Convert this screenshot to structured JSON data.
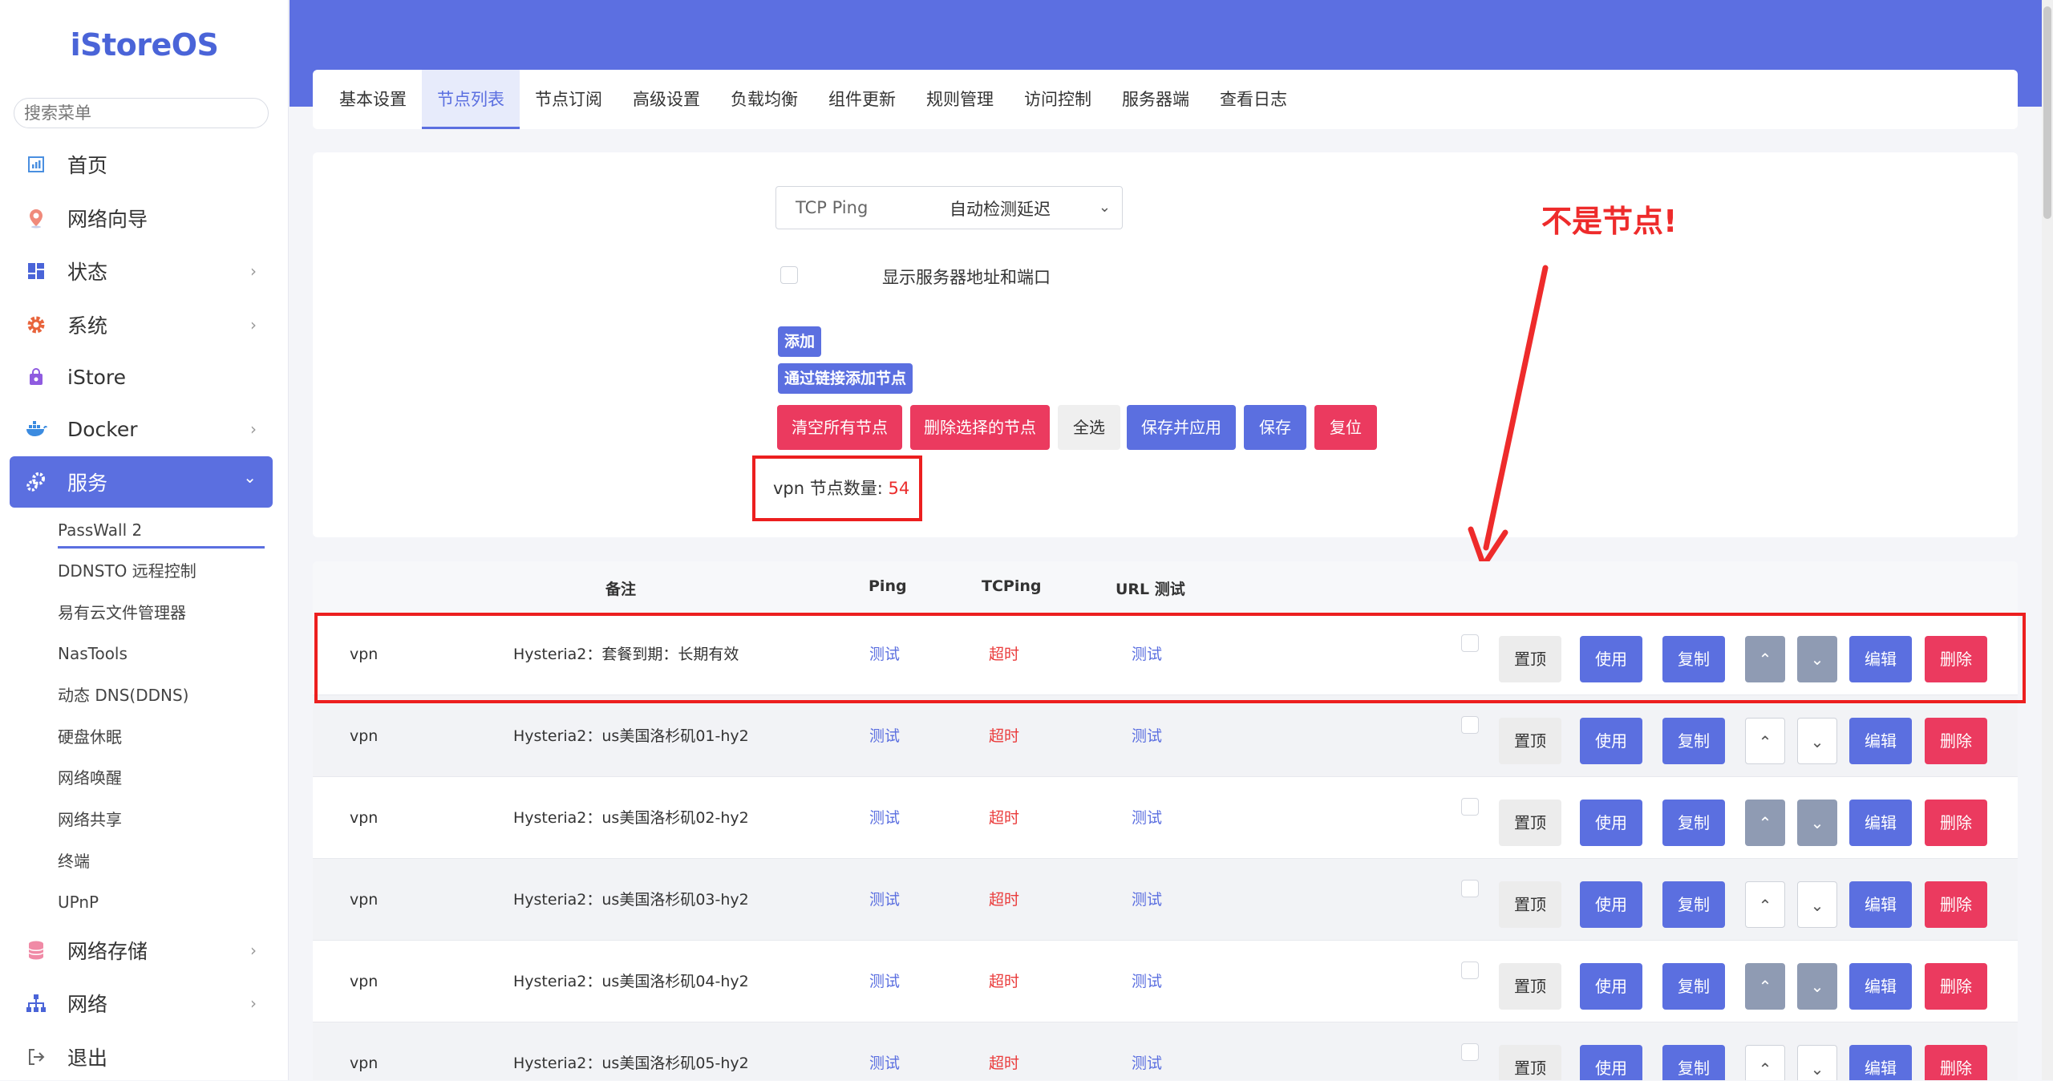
{
  "app": {
    "logo": "iStoreOS"
  },
  "sidebar": {
    "search_placeholder": "搜索菜单",
    "items": [
      {
        "label": "首页",
        "icon": "dashboard-icon"
      },
      {
        "label": "网络向导",
        "icon": "location-pin-icon"
      },
      {
        "label": "状态",
        "icon": "grid-icon",
        "has_arrow": true
      },
      {
        "label": "系统",
        "icon": "gear-icon",
        "has_arrow": true
      },
      {
        "label": "iStore",
        "icon": "store-bag-icon"
      },
      {
        "label": "Docker",
        "icon": "docker-whale-icon",
        "has_arrow": true
      },
      {
        "label": "服务",
        "icon": "services-gears-icon",
        "has_arrow": true,
        "active": true
      },
      {
        "label": "网络存储",
        "icon": "database-icon",
        "has_arrow": true
      },
      {
        "label": "网络",
        "icon": "network-tree-icon",
        "has_arrow": true
      },
      {
        "label": "退出",
        "icon": "logout-icon"
      }
    ],
    "service_sub": [
      "PassWall 2",
      "DDNSTO 远程控制",
      "易有云文件管理器",
      "NasTools",
      "动态 DNS(DDNS)",
      "硬盘休眠",
      "网络唤醒",
      "网络共享",
      "终端",
      "UPnP"
    ],
    "arrow_glyph": "›",
    "active_arrow_glyph": "⌄"
  },
  "tabs": [
    "基本设置",
    "节点列表",
    "节点订阅",
    "高级设置",
    "负载均衡",
    "组件更新",
    "规则管理",
    "访问控制",
    "服务器端",
    "查看日志"
  ],
  "settings": {
    "auto_latency_label": "自动检测延迟",
    "auto_latency_value": "TCP Ping",
    "show_addr_label": "显示服务器地址和端口",
    "add_label": "添加",
    "add_by_link_label": "通过链接添加节点",
    "clear_all_label": "清空所有节点",
    "delete_selected_label": "删除选择的节点",
    "select_all_label": "全选",
    "save_apply_label": "保存并应用",
    "save_label": "保存",
    "reset_label": "复位",
    "count_prefix": "vpn 节点数量: ",
    "count_value": "54"
  },
  "annotation": {
    "text": "不是节点!",
    "color": "#ee2b2b"
  },
  "table": {
    "headers": {
      "remark": "备注",
      "ping": "Ping",
      "tcping": "TCPing",
      "url_test": "URL 测试"
    },
    "action_labels": {
      "top": "置顶",
      "use": "使用",
      "copy": "复制",
      "up": "⌃",
      "down": "⌄",
      "edit": "编辑",
      "delete": "删除"
    },
    "rows": [
      {
        "group": "vpn",
        "remark": "Hysteria2：套餐到期：长期有效",
        "ping": "测试",
        "tcping": "超时",
        "url": "测试",
        "arrows_enabled": false
      },
      {
        "group": "vpn",
        "remark": "Hysteria2：us美国洛杉矶01-hy2",
        "ping": "测试",
        "tcping": "超时",
        "url": "测试",
        "arrows_enabled": true
      },
      {
        "group": "vpn",
        "remark": "Hysteria2：us美国洛杉矶02-hy2",
        "ping": "测试",
        "tcping": "超时",
        "url": "测试",
        "arrows_enabled": false
      },
      {
        "group": "vpn",
        "remark": "Hysteria2：us美国洛杉矶03-hy2",
        "ping": "测试",
        "tcping": "超时",
        "url": "测试",
        "arrows_enabled": true
      },
      {
        "group": "vpn",
        "remark": "Hysteria2：us美国洛杉矶04-hy2",
        "ping": "测试",
        "tcping": "超时",
        "url": "测试",
        "arrows_enabled": false
      },
      {
        "group": "vpn",
        "remark": "Hysteria2：us美国洛杉矶05-hy2",
        "ping": "测试",
        "tcping": "超时",
        "url": "测试",
        "arrows_enabled": true
      }
    ]
  },
  "colors": {
    "accent": "#5b6fe0",
    "danger": "#eb3a5f",
    "header": "#5c6fe1",
    "highlight": "#ec1f1f"
  }
}
